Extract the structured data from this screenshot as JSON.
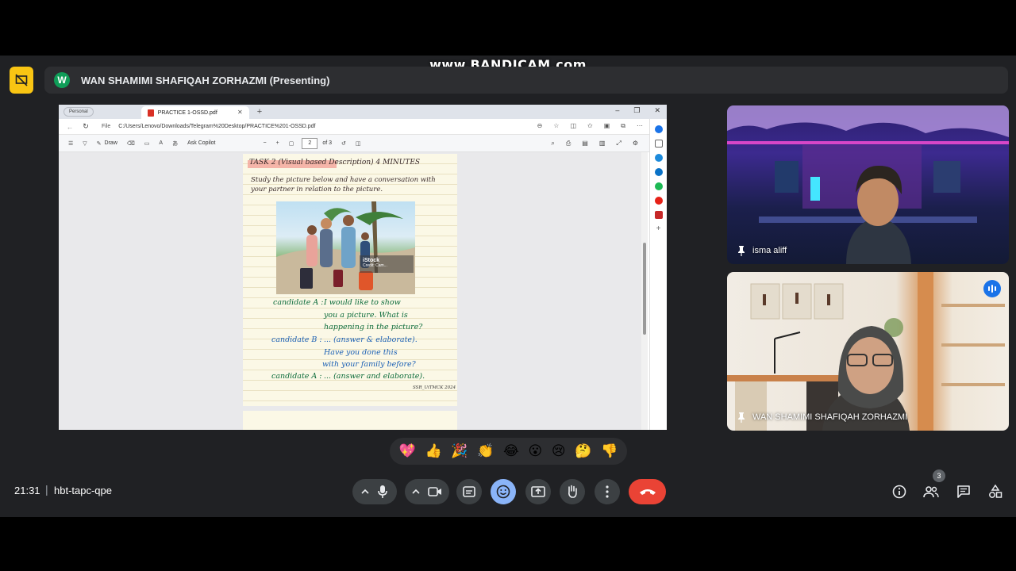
{
  "watermark": "www.BANDICAM.com",
  "presenting": {
    "avatar_letter": "W",
    "label": "WAN SHAMIMI SHAFIQAH ZORHAZMI (Presenting)"
  },
  "browser": {
    "profile": "Personal",
    "tab_title": "PRACTICE 1-OSSD.pdf",
    "url_scheme": "File",
    "url": "C:/Users/Lenovo/Downloads/Telegram%20Desktop/PRACTICE%201-OSSD.pdf",
    "toolbar": {
      "draw_label": "Draw",
      "copilot_label": "Ask Copilot",
      "page_current": "2",
      "page_total": "of 3"
    }
  },
  "document": {
    "heading": "TASK 2 (Visual based Description) 4 MINUTES",
    "instruction_line1": "Study the picture below and have a conversation with",
    "instruction_line2": "your partner in relation to the picture.",
    "photo_watermark": "iStock",
    "photo_credit": "Credit: Cam...",
    "dialogue": [
      {
        "speaker": "candidate A :",
        "text": "I would like to show"
      },
      {
        "speaker": "",
        "text": "you a picture. What is"
      },
      {
        "speaker": "",
        "text": "happening in the picture?"
      },
      {
        "speaker": "candidate B :",
        "text": "... (answer & elaborate)."
      },
      {
        "speaker": "",
        "text": "Have you done this"
      },
      {
        "speaker": "",
        "text": "with your family before?"
      },
      {
        "speaker": "candidate A :",
        "text": "... (answer and elaborate)."
      }
    ],
    "signature": "SSR_UiTMCK 2024"
  },
  "participants": [
    {
      "name": "isma aliff",
      "pinned": true
    },
    {
      "name": "WAN SHAMIMI SHAFIQAH ZORHAZMI",
      "pinned": true,
      "speaking": true
    }
  ],
  "reactions": [
    "💖",
    "👍",
    "🎉",
    "👏",
    "😂",
    "😮",
    "😢",
    "🤔",
    "👎"
  ],
  "meeting": {
    "time": "21:31",
    "separator": "|",
    "code": "hbt-tapc-qpe",
    "participants_count": "3"
  },
  "colors": {
    "background": "#202124",
    "leave_button": "#ea4335",
    "active_button": "#8ab4f8",
    "presenting_icon": "#f9c513",
    "speaking_indicator": "#1a73e8",
    "handwriting_green": "#0b6b3a",
    "handwriting_blue": "#1a5fb4",
    "handwriting_dark": "#3a2a2a"
  },
  "icons": {
    "presenting": "present-to-all-off-icon",
    "mic": "mic-icon",
    "camera": "videocam-icon",
    "captions": "closed-captions-icon",
    "emoji": "emoji-icon",
    "present": "present-screen-icon",
    "hand": "raise-hand-icon",
    "more": "more-vert-icon",
    "leave": "call-end-icon",
    "info": "info-icon",
    "people": "people-icon",
    "chat": "chat-icon",
    "activities": "activities-icon"
  }
}
